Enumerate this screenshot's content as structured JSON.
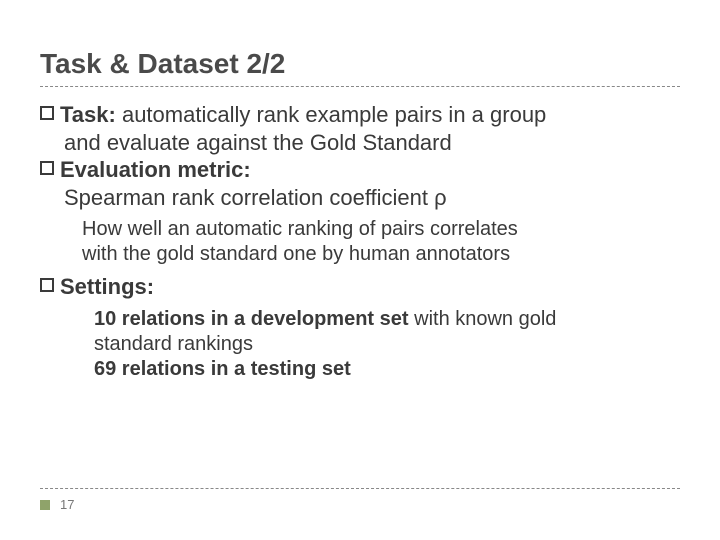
{
  "title": "Task & Dataset 2/2",
  "b1": {
    "label": "Task:",
    "text": "  automatically rank example pairs in a group"
  },
  "b1cont": "and evaluate against the Gold Standard",
  "b2": {
    "label": "Evaluation metric:"
  },
  "b2sub": "Spearman rank correlation coefficient ρ",
  "b2expl1": "How well an automatic ranking of pairs correlates",
  "b2expl2": "with the gold standard one by human annotators",
  "b3": {
    "label": "Settings:"
  },
  "s1a": "10 relations in a development set",
  "s1b": " with known gold",
  "s1c": "standard rankings",
  "s2": "69 relations in a testing set",
  "page": "17"
}
